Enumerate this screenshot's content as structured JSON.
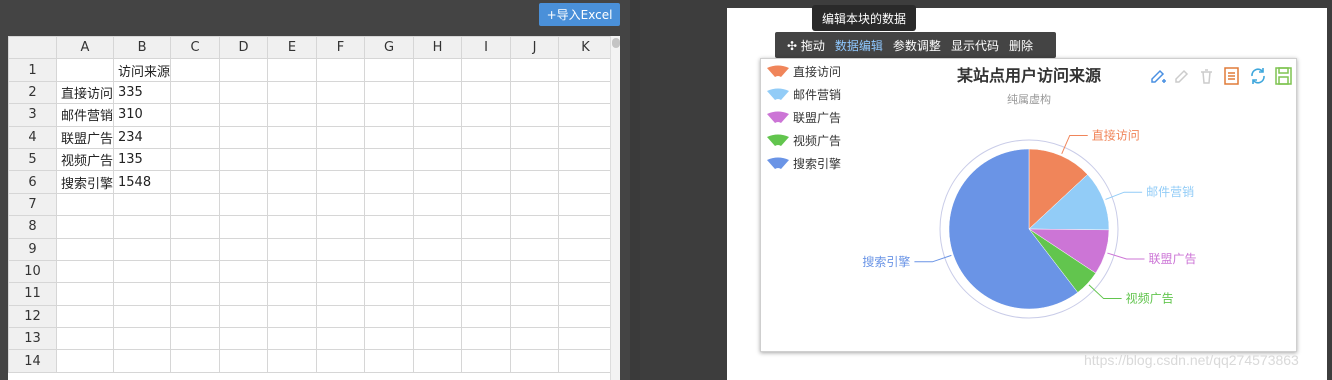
{
  "left": {
    "import_button_label": "+导入Excel",
    "columns": [
      "A",
      "B",
      "C",
      "D",
      "E",
      "F",
      "G",
      "H",
      "I",
      "J",
      "K"
    ],
    "rows": [
      {
        "n": "1",
        "cells": [
          "",
          "访问来源"
        ]
      },
      {
        "n": "2",
        "cells": [
          "直接访问",
          "335"
        ]
      },
      {
        "n": "3",
        "cells": [
          "邮件营销",
          "310"
        ]
      },
      {
        "n": "4",
        "cells": [
          "联盟广告",
          "234"
        ]
      },
      {
        "n": "5",
        "cells": [
          "视频广告",
          "135"
        ]
      },
      {
        "n": "6",
        "cells": [
          "搜索引擎",
          "1548"
        ]
      },
      {
        "n": "7",
        "cells": [
          "",
          ""
        ]
      },
      {
        "n": "8",
        "cells": [
          "",
          ""
        ]
      },
      {
        "n": "9",
        "cells": [
          "",
          ""
        ]
      },
      {
        "n": "10",
        "cells": [
          "",
          ""
        ]
      },
      {
        "n": "11",
        "cells": [
          "",
          ""
        ]
      },
      {
        "n": "12",
        "cells": [
          "",
          ""
        ]
      },
      {
        "n": "13",
        "cells": [
          "",
          ""
        ]
      },
      {
        "n": "14",
        "cells": [
          "",
          ""
        ]
      }
    ]
  },
  "right": {
    "tooltip": "编辑本块的数据",
    "toolbar": {
      "drag": "拖动",
      "data_edit": "数据编辑",
      "param_adjust": "参数调整",
      "show_code": "显示代码",
      "delete": "删除"
    },
    "tool_icons": [
      "edit-add-icon",
      "edit-icon",
      "clear-icon",
      "data-view-icon",
      "refresh-icon",
      "save-image-icon"
    ],
    "watermark": "https://blog.csdn.net/qq274573863"
  },
  "chart_data": {
    "type": "pie",
    "title": "某站点用户访问来源",
    "subtitle": "纯属虚构",
    "legend_position": "top-left",
    "series": [
      {
        "name": "直接访问",
        "value": 335,
        "color": "#f0855a"
      },
      {
        "name": "邮件营销",
        "value": 310,
        "color": "#92ccf7"
      },
      {
        "name": "联盟广告",
        "value": 234,
        "color": "#cc75d6"
      },
      {
        "name": "视频广告",
        "value": 135,
        "color": "#62c54e"
      },
      {
        "name": "搜索引擎",
        "value": 1548,
        "color": "#6a94e6"
      }
    ]
  }
}
